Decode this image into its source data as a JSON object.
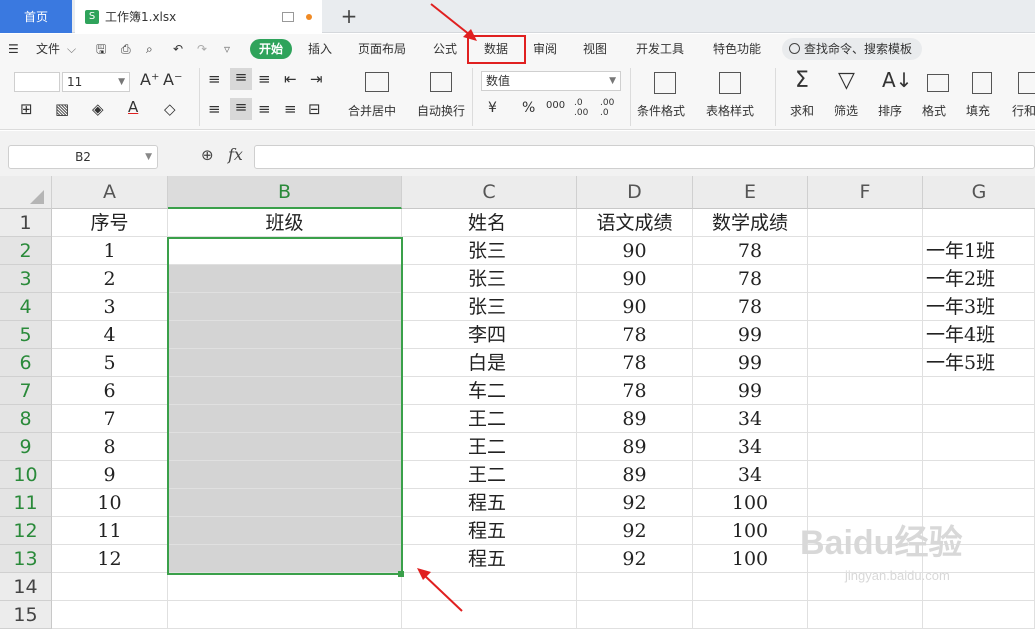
{
  "tabs": {
    "home": "首页",
    "file": "工作簿1.xlsx",
    "new_tab": "+"
  },
  "menu": {
    "file": "文件",
    "items": [
      "开始",
      "插入",
      "页面布局",
      "公式",
      "数据",
      "审阅",
      "视图",
      "开发工具",
      "特色功能"
    ],
    "search_placeholder": "查找命令、搜索模板"
  },
  "ribbon": {
    "font_size": "11",
    "number_format": "数值",
    "labels": {
      "merge": "合并居中",
      "wrap": "自动换行",
      "cond_format": "条件格式",
      "table_style": "表格样式",
      "sum": "求和",
      "filter": "筛选",
      "sort": "排序",
      "format": "格式",
      "fill": "填充",
      "rowcol": "行和"
    }
  },
  "formula_bar": {
    "name_box": "B2",
    "fx": "fx",
    "value": ""
  },
  "sheet": {
    "columns": [
      "A",
      "B",
      "C",
      "D",
      "E",
      "F",
      "G"
    ],
    "row_numbers": [
      "1",
      "2",
      "3",
      "4",
      "5",
      "6",
      "7",
      "8",
      "9",
      "10",
      "11",
      "12",
      "13",
      "14",
      "15"
    ],
    "headers": {
      "a": "序号",
      "b": "班级",
      "c": "姓名",
      "d": "语文成绩",
      "e": "数学成绩"
    },
    "rows": [
      {
        "a": "1",
        "c": "张三",
        "d": "90",
        "e": "78",
        "g": "一年1班"
      },
      {
        "a": "2",
        "c": "张三",
        "d": "90",
        "e": "78",
        "g": "一年2班"
      },
      {
        "a": "3",
        "c": "张三",
        "d": "90",
        "e": "78",
        "g": "一年3班"
      },
      {
        "a": "4",
        "c": "李四",
        "d": "78",
        "e": "99",
        "g": "一年4班"
      },
      {
        "a": "5",
        "c": "白是",
        "d": "78",
        "e": "99",
        "g": "一年5班"
      },
      {
        "a": "6",
        "c": "车二",
        "d": "78",
        "e": "99",
        "g": ""
      },
      {
        "a": "7",
        "c": "王二",
        "d": "89",
        "e": "34",
        "g": ""
      },
      {
        "a": "8",
        "c": "王二",
        "d": "89",
        "e": "34",
        "g": ""
      },
      {
        "a": "9",
        "c": "王二",
        "d": "89",
        "e": "34",
        "g": ""
      },
      {
        "a": "10",
        "c": "程五",
        "d": "92",
        "e": "100",
        "g": ""
      },
      {
        "a": "11",
        "c": "程五",
        "d": "92",
        "e": "100",
        "g": ""
      },
      {
        "a": "12",
        "c": "程五",
        "d": "92",
        "e": "100",
        "g": ""
      }
    ],
    "selected_range": "B2:B13"
  },
  "colors": {
    "accent_green": "#2fa35b",
    "home_blue": "#3a79e0",
    "annotation_red": "#e02020",
    "selection_border": "#3aa04a",
    "selection_fill": "#d4d4d4"
  }
}
